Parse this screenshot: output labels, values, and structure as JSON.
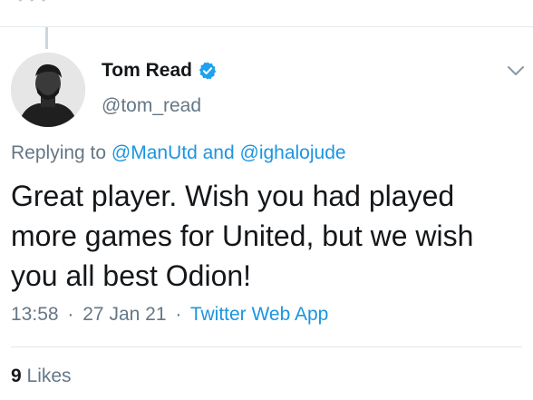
{
  "tweet": {
    "author": {
      "display_name": "Tom Read",
      "handle": "@tom_read",
      "verified": true
    },
    "replying_prefix": "Replying to",
    "replying_mentions": [
      "@ManUtd",
      "@ighalojude"
    ],
    "replying_joiner": "and",
    "text": "Great player. Wish you had played more games for United, but we wish you all best Odion!",
    "time": "13:58",
    "date": "27 Jan 21",
    "source": "Twitter Web App",
    "separator": "·",
    "likes_count": "9",
    "likes_label": "Likes"
  },
  "colors": {
    "accent": "#1b95e0",
    "secondary_text": "#657786",
    "primary_text": "#14171a"
  },
  "icons": {
    "verified": "verified-badge-icon",
    "caret": "chevron-down-icon"
  }
}
